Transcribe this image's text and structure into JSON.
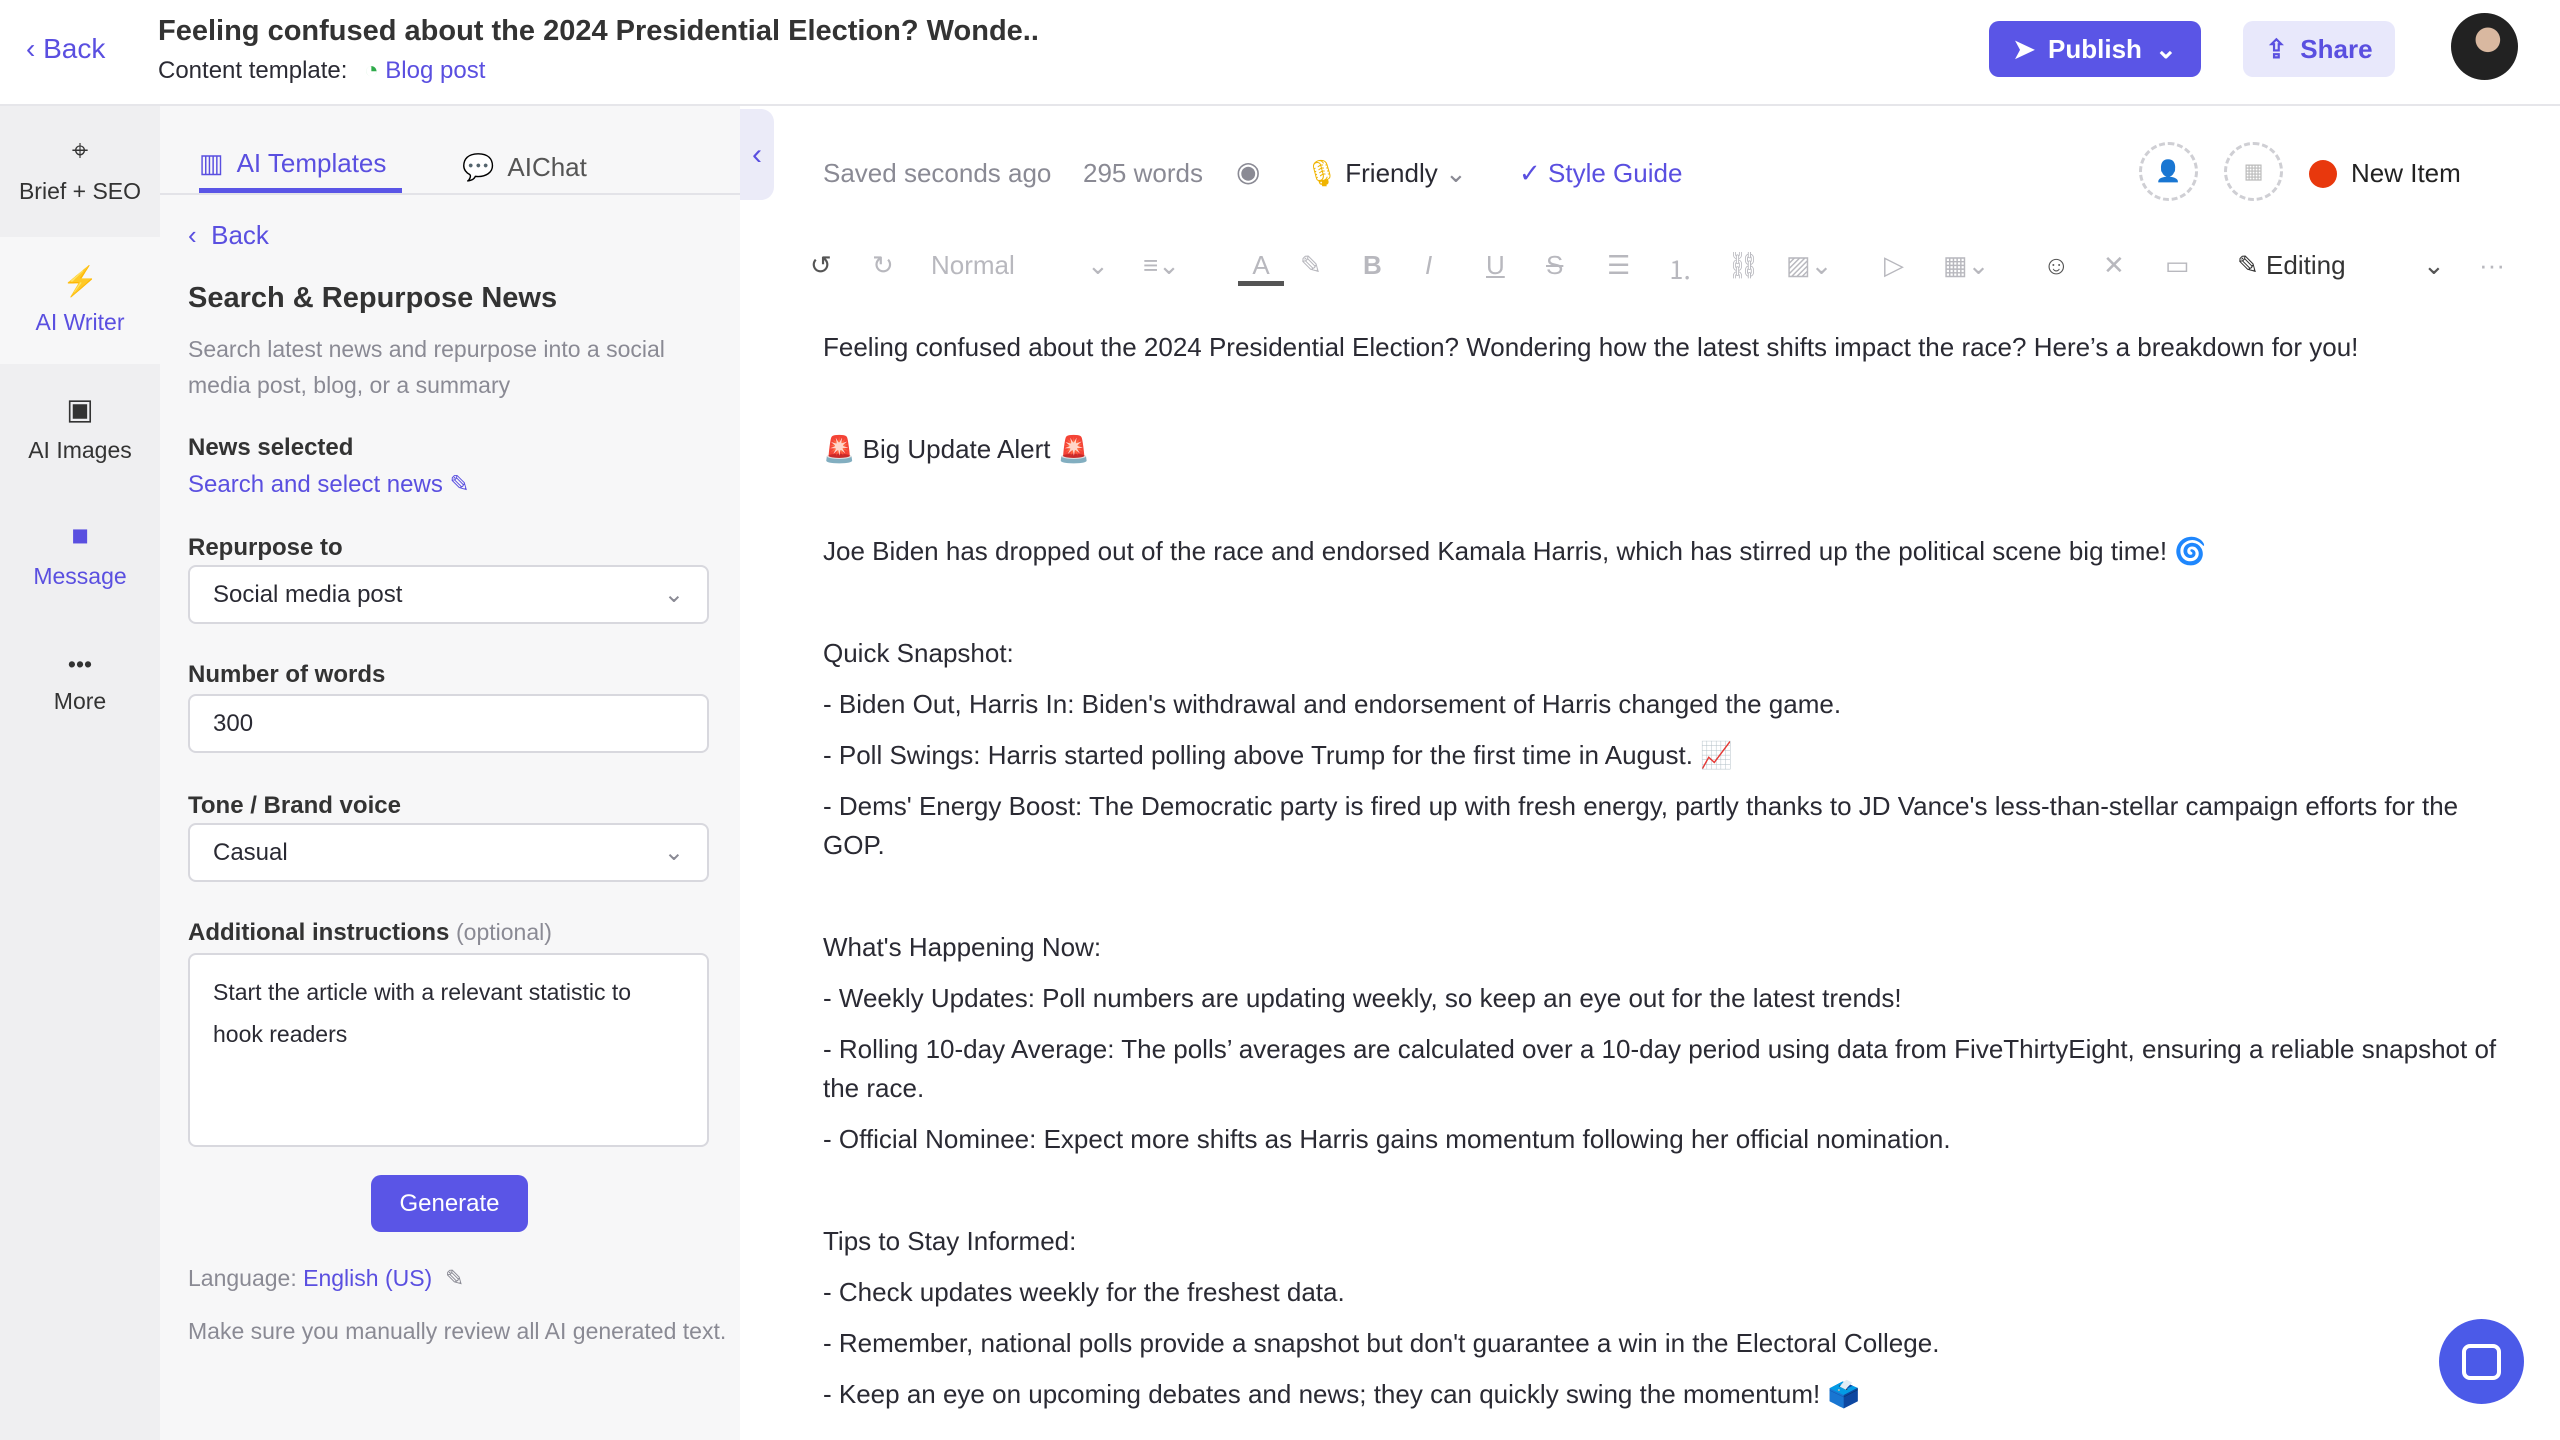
{
  "header": {
    "back": "Back",
    "title": "Feeling confused about the 2024 Presidential Election? Wonde..",
    "template_label": "Content template:",
    "template_value": "Blog post",
    "publish": "Publish",
    "share": "Share"
  },
  "nav": [
    {
      "label": "Brief + SEO",
      "icon": "crosshair-icon"
    },
    {
      "label": "AI Writer",
      "icon": "bolt-icon"
    },
    {
      "label": "AI Images",
      "icon": "image-icon"
    },
    {
      "label": "Message",
      "icon": "message-icon"
    },
    {
      "label": "More",
      "icon": "more-icon"
    }
  ],
  "panel": {
    "tabs": [
      "AI Templates",
      "AIChat"
    ],
    "back": "Back",
    "title": "Search & Repurpose News",
    "description": "Search latest news and repurpose into a social media post, blog, or a summary",
    "news_label": "News selected",
    "news_link": "Search and select news",
    "repurpose_label": "Repurpose to",
    "repurpose_value": "Social media post",
    "words_label": "Number of words",
    "words_value": "300",
    "tone_label": "Tone / Brand voice",
    "tone_value": "Casual",
    "instructions_label": "Additional instructions",
    "instructions_optional": "(optional)",
    "instructions_value": "Start the article with a relevant statistic to hook readers",
    "generate": "Generate",
    "language_label": "Language:",
    "language_value": "English (US)",
    "disclaimer": "Make sure you manually review all AI generated text."
  },
  "status": {
    "saved": "Saved seconds ago",
    "words": "295 words",
    "tone": "Friendly",
    "style_guide": "Style Guide",
    "new_item": "New Item"
  },
  "toolbar": {
    "style": "Normal",
    "mode": "Editing"
  },
  "colors": {
    "accent": "#5a55e6",
    "status_dot": "#e8380d",
    "template_icon": "#2eaa4a"
  },
  "content": {
    "lines": [
      "Feeling confused about the 2024 Presidential Election? Wondering how the latest shifts impact the race? Here’s a breakdown for you!",
      "",
      "🚨 Big Update Alert 🚨",
      "",
      "Joe Biden has dropped out of the race and endorsed Kamala Harris, which has stirred up the political scene big time! 🌀",
      "",
      "Quick Snapshot:",
      "- Biden Out, Harris In: Biden's withdrawal and endorsement of Harris changed the game.",
      "- Poll Swings: Harris started polling above Trump for the first time in August. 📈",
      "- Dems' Energy Boost: The Democratic party is fired up with fresh energy, partly thanks to JD Vance's less-than-stellar campaign efforts for the GOP.",
      "",
      "What's Happening Now:",
      "- Weekly Updates: Poll numbers are updating weekly, so keep an eye out for the latest trends!",
      "- Rolling 10-day Average: The polls’ averages are calculated over a 10-day period using data from FiveThirtyEight, ensuring a reliable snapshot of the race.",
      "- Official Nominee: Expect more shifts as Harris gains momentum following her official nomination.",
      "",
      "Tips to Stay Informed:",
      "- Check updates weekly for the freshest data.",
      "- Remember, national polls provide a snapshot but don't guarantee a win in the Electoral College.",
      "- Keep an eye on upcoming debates and news; they can quickly swing the momentum! 🗳️"
    ]
  }
}
